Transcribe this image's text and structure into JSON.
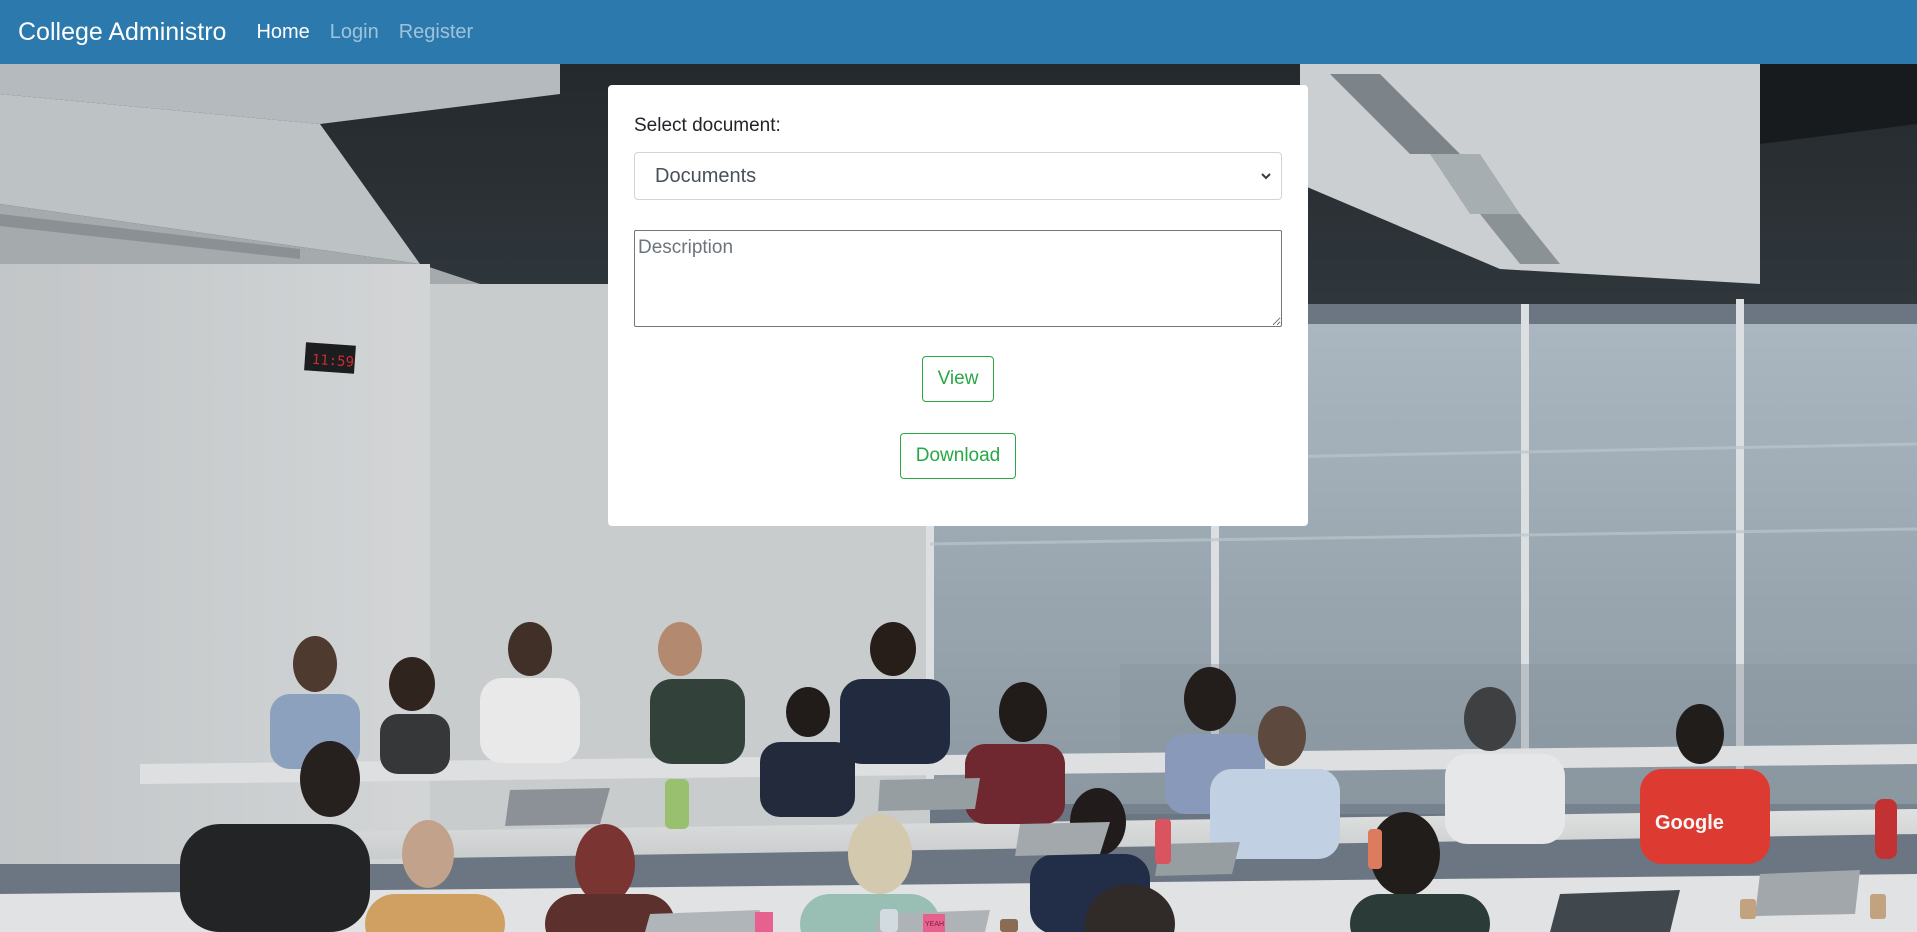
{
  "navbar": {
    "brand": "College Administro",
    "links": [
      {
        "label": "Home",
        "active": true
      },
      {
        "label": "Login",
        "active": false
      },
      {
        "label": "Register",
        "active": false
      }
    ],
    "background_color": "#2b79ad"
  },
  "form": {
    "select_label": "Select document:",
    "select_value": "Documents",
    "description_placeholder": "Description",
    "view_button": "View",
    "download_button": "Download",
    "button_color": "#28a745"
  },
  "background": {
    "clock_text": "11:59",
    "shirt_text": "Google",
    "sticky_note_text": "YEAH"
  }
}
